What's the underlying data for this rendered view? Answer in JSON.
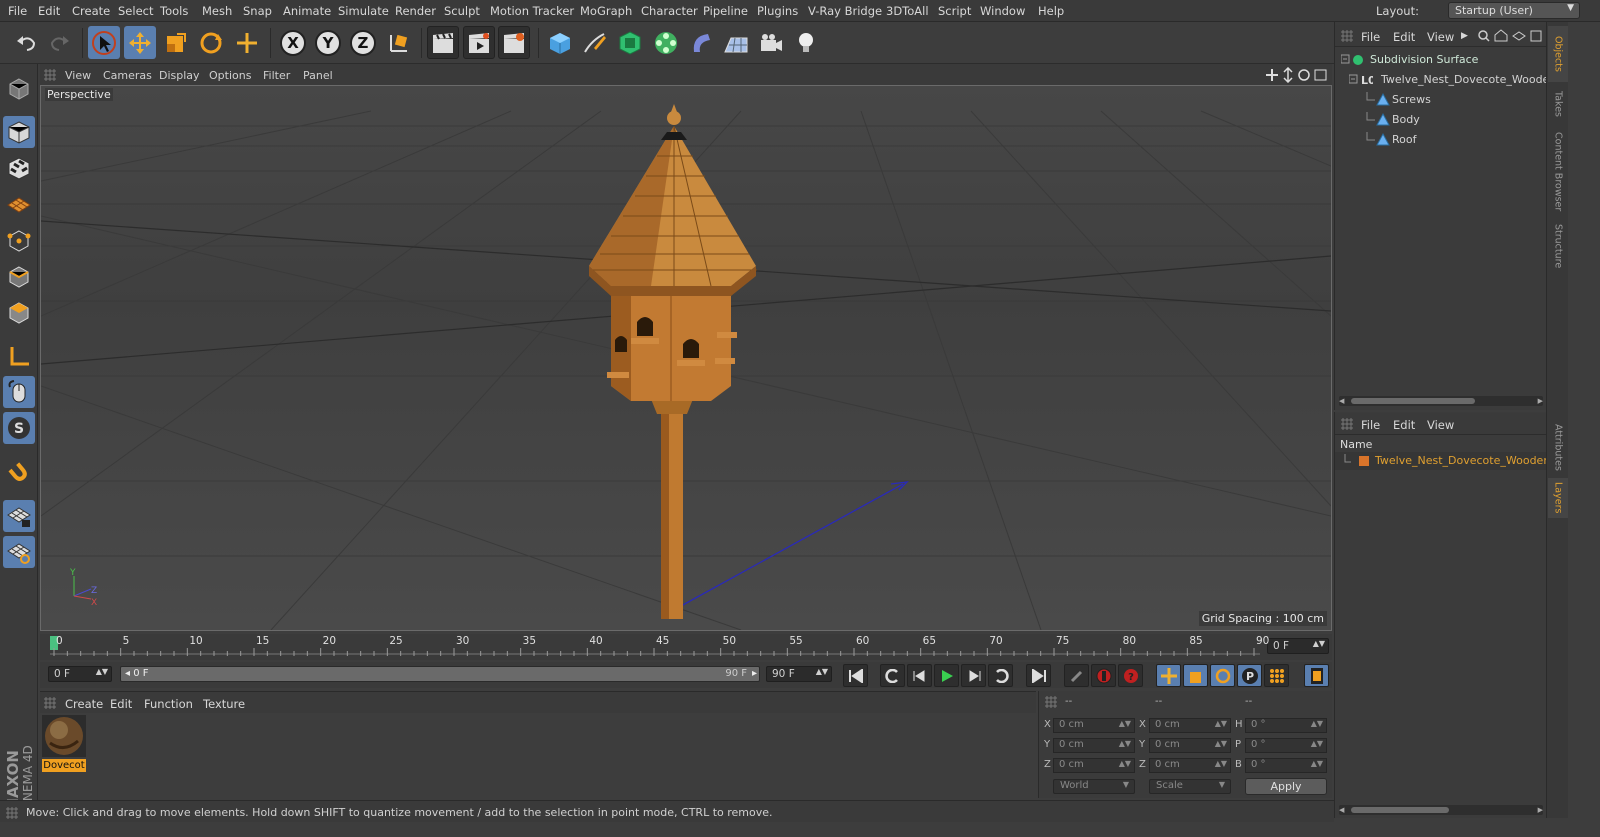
{
  "menubar": {
    "items": [
      "File",
      "Edit",
      "Create",
      "Select",
      "Tools",
      "Mesh",
      "Snap",
      "Animate",
      "Simulate",
      "Render",
      "Sculpt",
      "Motion Tracker",
      "MoGraph",
      "Character",
      "Pipeline",
      "Plugins",
      "V-Ray Bridge",
      "3DToAll",
      "Script",
      "Window",
      "Help"
    ],
    "layout_label": "Layout:",
    "layout_value": "Startup (User)"
  },
  "toolbar": {
    "axis_x": "X",
    "axis_y": "Y",
    "axis_z": "Z"
  },
  "viewport": {
    "menu": [
      "View",
      "Cameras",
      "Display",
      "Options",
      "Filter",
      "Panel"
    ],
    "label": "Perspective",
    "grid_spacing": "Grid Spacing : 100 cm",
    "axis_y": "Y",
    "axis_z": "Z",
    "axis_x": "X"
  },
  "timeline": {
    "ticks": [
      "0",
      "5",
      "10",
      "15",
      "20",
      "25",
      "30",
      "35",
      "40",
      "45",
      "50",
      "55",
      "60",
      "65",
      "70",
      "75",
      "80",
      "85",
      "90"
    ],
    "end_field": "0 F"
  },
  "frames": {
    "current": "0 F",
    "slider_start": "0 F",
    "slider_end": "90 F",
    "max": "90 F"
  },
  "material_manager": {
    "menu": [
      "Create",
      "Edit",
      "Function",
      "Texture"
    ],
    "material_name": "Dovecot"
  },
  "coordinates": {
    "header": [
      "--",
      "--",
      "--"
    ],
    "rows": [
      {
        "l1": "X",
        "v1": "0 cm",
        "l2": "X",
        "v2": "0 cm",
        "l3": "H",
        "v3": "0 °"
      },
      {
        "l1": "Y",
        "v1": "0 cm",
        "l2": "Y",
        "v2": "0 cm",
        "l3": "P",
        "v3": "0 °"
      },
      {
        "l1": "Z",
        "v1": "0 cm",
        "l2": "Z",
        "v2": "0 cm",
        "l3": "B",
        "v3": "0 °"
      }
    ],
    "mode_world": "World",
    "mode_scale": "Scale",
    "apply": "Apply"
  },
  "status": {
    "text": "Move: Click and drag to move elements. Hold down SHIFT to quantize movement / add to the selection in point mode, CTRL to remove."
  },
  "objects_panel": {
    "menu": [
      "File",
      "Edit",
      "View"
    ],
    "tree": [
      {
        "name": "Subdivision Surface",
        "indent": 0
      },
      {
        "name": "Twelve_Nest_Dovecote_Wooden",
        "indent": 1
      },
      {
        "name": "Screws",
        "indent": 2
      },
      {
        "name": "Body",
        "indent": 2
      },
      {
        "name": "Roof",
        "indent": 2
      }
    ]
  },
  "layers_panel": {
    "menu": [
      "File",
      "Edit",
      "View"
    ],
    "column": "Name",
    "layer": "Twelve_Nest_Dovecote_Wooden",
    "layer_color": "#d9742a"
  },
  "side_tabs": {
    "top": [
      "Objects",
      "Takes",
      "Content Browser",
      "Structure"
    ],
    "bottom": [
      "Attributes",
      "Layers"
    ]
  },
  "brand": {
    "maxon": "MAXON",
    "product": "CINEMA 4D"
  },
  "colors": {
    "accent_blue": "#5a7fb0",
    "selection_orange": "#e0a030",
    "wood": "#c07a30"
  }
}
